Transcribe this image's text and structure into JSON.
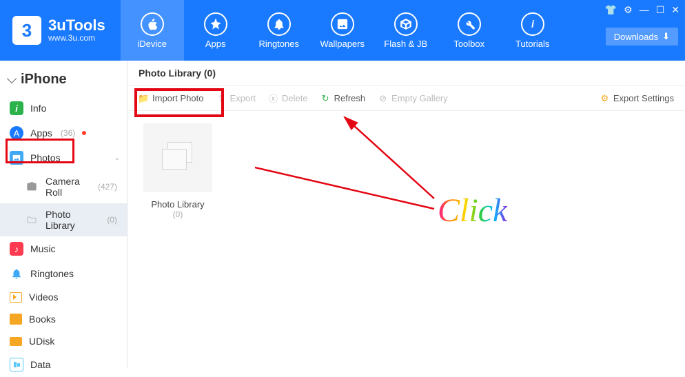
{
  "app": {
    "title": "3uTools",
    "subtitle": "www.3u.com"
  },
  "nav": [
    {
      "label": "iDevice",
      "active": true
    },
    {
      "label": "Apps"
    },
    {
      "label": "Ringtones"
    },
    {
      "label": "Wallpapers"
    },
    {
      "label": "Flash & JB"
    },
    {
      "label": "Toolbox"
    },
    {
      "label": "Tutorials"
    }
  ],
  "downloads_label": "Downloads",
  "device": {
    "name": "iPhone"
  },
  "sidebar": {
    "info": "Info",
    "apps": "Apps",
    "apps_count": "(36)",
    "photos": "Photos",
    "camera_roll": "Camera Roll",
    "camera_roll_count": "(427)",
    "photo_library": "Photo Library",
    "photo_library_count": "(0)",
    "music": "Music",
    "ringtones": "Ringtones",
    "videos": "Videos",
    "books": "Books",
    "udisk": "UDisk",
    "data": "Data"
  },
  "content": {
    "title": "Photo Library (0)",
    "toolbar": {
      "import": "Import Photo",
      "export": "Export",
      "delete": "Delete",
      "refresh": "Refresh",
      "empty": "Empty Gallery",
      "settings": "Export Settings"
    },
    "album": {
      "label": "Photo Library",
      "count": "(0)"
    }
  },
  "annotation": {
    "click": "Click"
  }
}
